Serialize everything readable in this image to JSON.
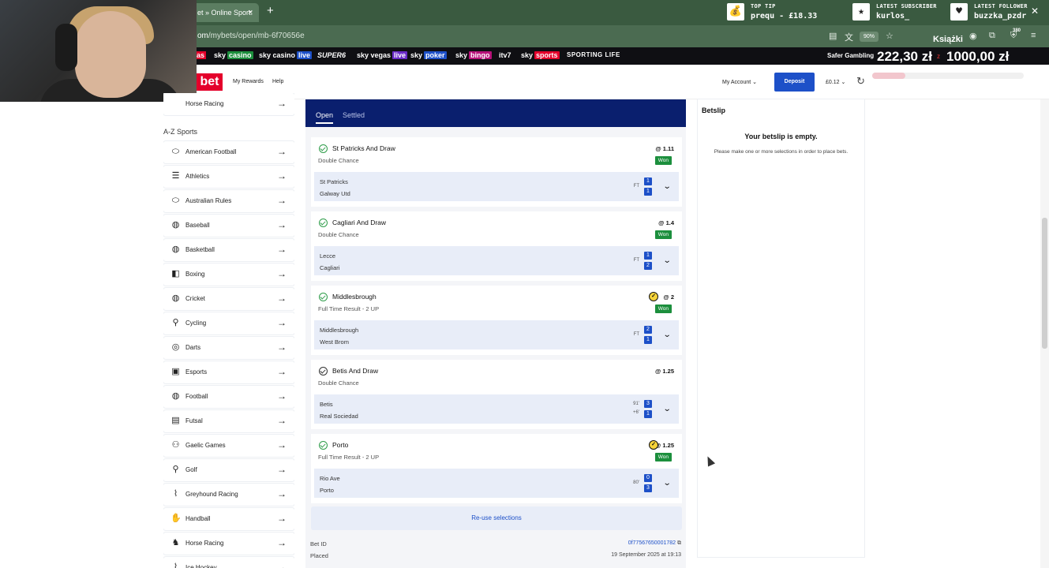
{
  "browser": {
    "tab_title": "et » Online Sport:",
    "tab_close": "×",
    "new_tab": "+",
    "url_prefix": "om",
    "url_path": "/mybets/open/mb-6f70656e",
    "zoom": "90%",
    "bookmark_label": "Książki",
    "menu_badge": "380"
  },
  "alerts": [
    {
      "title": "TOP TIP",
      "value": "prequ - £18.33",
      "icon": "money-bag-icon",
      "glyph": "💰"
    },
    {
      "title": "LATEST SUBSCRIBER",
      "value": "kurlos_",
      "icon": "star-icon",
      "glyph": "★"
    },
    {
      "title": "LATEST FOLLOWER",
      "value": "buzzka_pzdr",
      "icon": "heart-icon",
      "glyph": "♥"
    }
  ],
  "skybar": {
    "items": [
      {
        "text": "as",
        "suffix": ""
      },
      {
        "text": "sky",
        "suffix": "casino"
      },
      {
        "text": "sky casino",
        "suffix": "live"
      },
      {
        "text": "SUPER6",
        "suffix": ""
      },
      {
        "text": "sky vegas",
        "suffix": "live"
      },
      {
        "text": "sky",
        "suffix": "poker"
      },
      {
        "text": "sky",
        "suffix": "bingo"
      },
      {
        "text": "itv7",
        "suffix": ""
      },
      {
        "text": "sky",
        "suffix": "sports"
      },
      {
        "text": "SPORTING LIFE",
        "suffix": ""
      }
    ],
    "safer_gambling": "Safer Gambling",
    "overlay_balance_1": "222,30 zł",
    "overlay_sep": "z",
    "overlay_balance_2": "1000,00 zł"
  },
  "header": {
    "logo": "bet",
    "my_rewards": "My Rewards",
    "help": "Help",
    "my_account": "My Account ⌄",
    "deposit": "Deposit",
    "balance": "£0.12 ⌄",
    "progress": 0.22
  },
  "sidebar": {
    "top_item": "Horse Racing",
    "az_title": "A-Z Sports",
    "items": [
      {
        "label": "American Football",
        "glyph": "⬭",
        "icon": "american-football-icon"
      },
      {
        "label": "Athletics",
        "glyph": "☰",
        "icon": "athletics-icon"
      },
      {
        "label": "Australian Rules",
        "glyph": "⬭",
        "icon": "australian-rules-icon"
      },
      {
        "label": "Baseball",
        "glyph": "◍",
        "icon": "baseball-icon"
      },
      {
        "label": "Basketball",
        "glyph": "◍",
        "icon": "basketball-icon"
      },
      {
        "label": "Boxing",
        "glyph": "◧",
        "icon": "boxing-icon"
      },
      {
        "label": "Cricket",
        "glyph": "◍",
        "icon": "cricket-icon"
      },
      {
        "label": "Cycling",
        "glyph": "⚲",
        "icon": "cycling-icon"
      },
      {
        "label": "Darts",
        "glyph": "◎",
        "icon": "darts-icon"
      },
      {
        "label": "Esports",
        "glyph": "▣",
        "icon": "esports-icon"
      },
      {
        "label": "Football",
        "glyph": "◍",
        "icon": "football-icon"
      },
      {
        "label": "Futsal",
        "glyph": "▤",
        "icon": "futsal-icon"
      },
      {
        "label": "Gaelic Games",
        "glyph": "⚇",
        "icon": "gaelic-games-icon"
      },
      {
        "label": "Golf",
        "glyph": "⚲",
        "icon": "golf-icon"
      },
      {
        "label": "Greyhound Racing",
        "glyph": "⌇",
        "icon": "greyhound-icon"
      },
      {
        "label": "Handball",
        "glyph": "✋",
        "icon": "handball-icon"
      },
      {
        "label": "Horse Racing",
        "glyph": "♞",
        "icon": "horse-racing-icon"
      },
      {
        "label": "Ice Hockey",
        "glyph": "⌇",
        "icon": "ice-hockey-icon"
      }
    ]
  },
  "mybets": {
    "tabs": [
      "Open",
      "Settled"
    ],
    "legs": [
      {
        "selection": "St Patricks And Draw",
        "market": "Double Chance",
        "odds": "@ 1.11",
        "status": "Won",
        "cashed": false,
        "pending": false,
        "home": "St Patricks",
        "away": "Galway Utd",
        "clock1": "FT",
        "clock2": "",
        "score_home": "1",
        "score_away": "1"
      },
      {
        "selection": "Cagliari And Draw",
        "market": "Double Chance",
        "odds": "@ 1.4",
        "status": "Won",
        "cashed": false,
        "pending": false,
        "home": "Lecce",
        "away": "Cagliari",
        "clock1": "FT",
        "clock2": "",
        "score_home": "1",
        "score_away": "2"
      },
      {
        "selection": "Middlesbrough",
        "market": "Full Time Result - 2 UP",
        "odds": "@ 2",
        "status": "Won",
        "cashed": true,
        "pending": false,
        "home": "Middlesbrough",
        "away": "West Brom",
        "clock1": "FT",
        "clock2": "",
        "score_home": "2",
        "score_away": "1"
      },
      {
        "selection": "Betis And Draw",
        "market": "Double Chance",
        "odds": "@ 1.25",
        "status": "",
        "cashed": false,
        "pending": true,
        "home": "Betis",
        "away": "Real Sociedad",
        "clock1": "91'",
        "clock2": "+6'",
        "score_home": "3",
        "score_away": "1"
      },
      {
        "selection": "Porto",
        "market": "Full Time Result - 2 UP",
        "odds": "@ 1.25",
        "status": "Won",
        "cashed": true,
        "pending": false,
        "home": "Rio Ave",
        "away": "Porto",
        "clock1": "80'",
        "clock2": "",
        "score_home": "0",
        "score_away": "3"
      }
    ],
    "reuse": "Re-use selections",
    "bet_id_label": "Bet ID",
    "bet_id_value": "0f77567650001782",
    "placed_label": "Placed",
    "placed_value": "19 September 2025 at 19:13"
  },
  "betslip": {
    "title": "Betslip",
    "empty": "Your betslip is empty.",
    "message": "Please make one or more selections in order to place bets."
  },
  "colors": {
    "accent": "#1d50c8",
    "won": "#1c8f3d",
    "nav": "#0a1f6e",
    "brand": "#e4002b"
  }
}
